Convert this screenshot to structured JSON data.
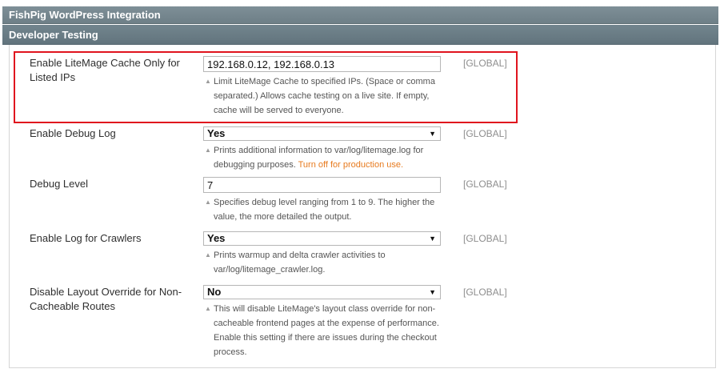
{
  "sections": {
    "fishpig": "FishPig WordPress Integration",
    "developer_testing": "Developer Testing"
  },
  "rows": [
    {
      "label": "Enable LiteMage Cache Only for Listed IPs",
      "value": "192.168.0.12, 192.168.0.13",
      "note": "Limit LiteMage Cache to specified IPs. (Space or comma separated.) Allows cache testing on a live site. If empty, cache will be served to everyone.",
      "scope": "[GLOBAL]"
    },
    {
      "label": "Enable Debug Log",
      "value": "Yes",
      "note": "Prints additional information to var/log/litemage.log for debugging purposes.",
      "note_warning": "Turn off for production use.",
      "scope": "[GLOBAL]"
    },
    {
      "label": "Debug Level",
      "value": "7",
      "note": "Specifies debug level ranging from 1 to 9. The higher the value, the more detailed the output.",
      "scope": "[GLOBAL]"
    },
    {
      "label": "Enable Log for Crawlers",
      "value": "Yes",
      "note": "Prints warmup and delta crawler activities to var/log/litemage_crawler.log.",
      "scope": "[GLOBAL]"
    },
    {
      "label": "Disable Layout Override for Non-Cacheable Routes",
      "value": "No",
      "note": "This will disable LiteMage's layout class override for non-cacheable frontend pages at the expense of performance. Enable this setting if there are issues during the checkout process.",
      "scope": "[GLOBAL]"
    }
  ],
  "icons": {
    "select_arrow": "▼",
    "note_marker": "▲"
  },
  "colors": {
    "section_header": "#6e7f87",
    "highlight_border": "#e0141e",
    "warning_text": "#e77a1e",
    "scope_text": "#8e8e8e"
  }
}
